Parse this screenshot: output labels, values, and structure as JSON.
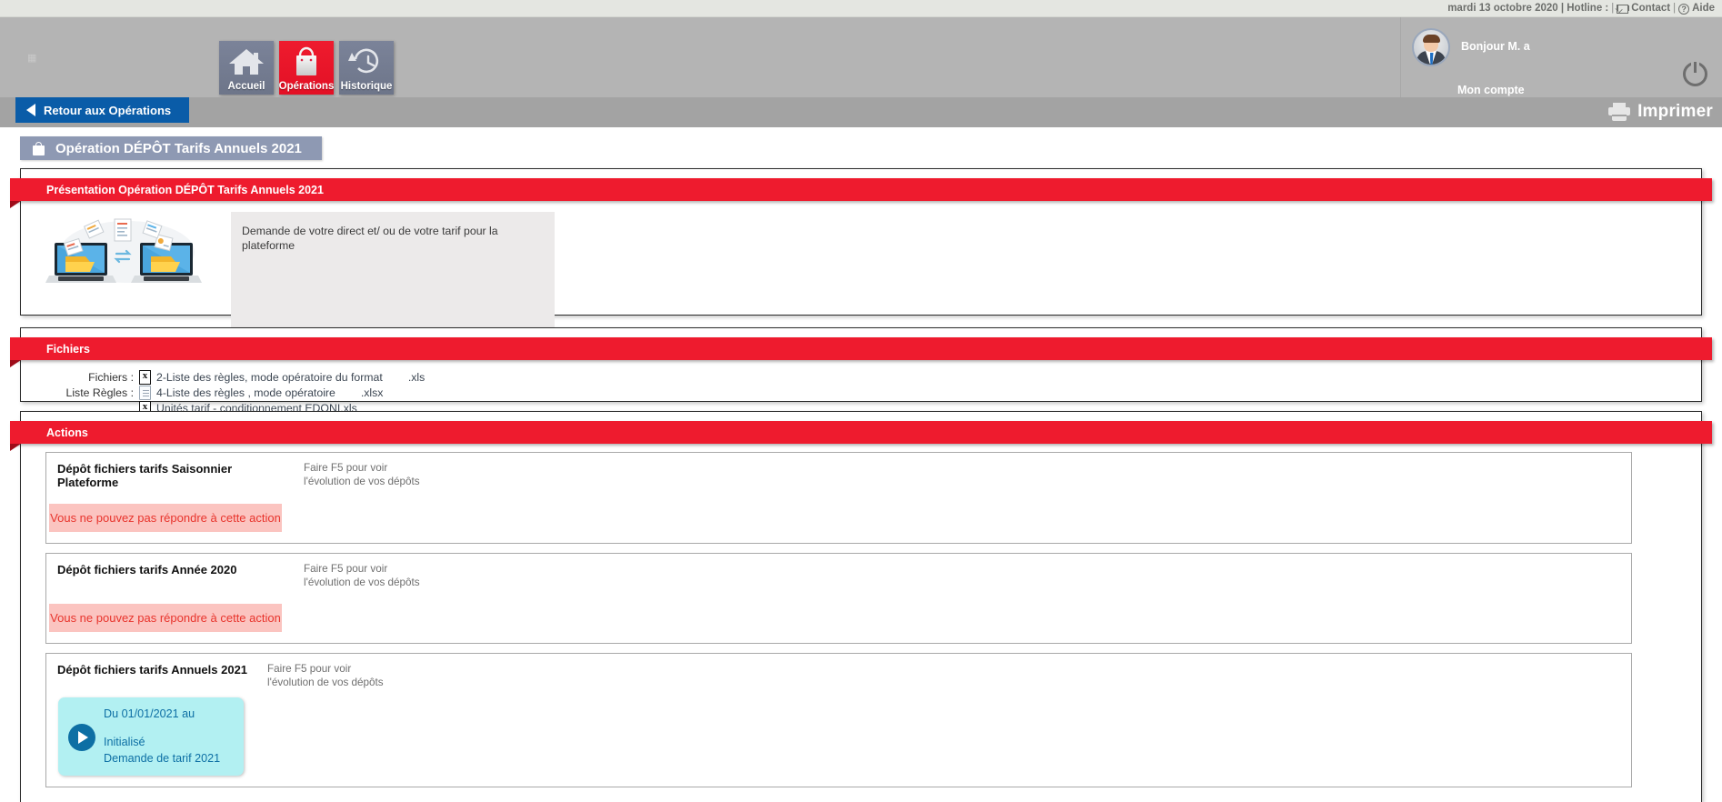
{
  "topbar": {
    "date_hotline": "mardi 13 octobre 2020 | Hotline :",
    "separator": "|",
    "contact_label": "Contact",
    "help_label": "Aide",
    "contact_icon": "mail-icon",
    "help_icon": "question-circle-icon"
  },
  "header": {
    "nav": [
      {
        "label": "Accueil",
        "icon": "home-icon",
        "active": false
      },
      {
        "label": "Opérations",
        "icon": "shopping-bag-icon",
        "active": true
      },
      {
        "label": "Historique",
        "icon": "clock-history-icon",
        "active": false
      }
    ],
    "account": {
      "greeting": "Bonjour M. a",
      "my_account_label": "Mon compte",
      "avatar_icon": "user-avatar",
      "logout_icon": "power-icon"
    }
  },
  "strip": {
    "back_label": "Retour aux Opérations",
    "back_icon": "arrow-left-icon",
    "print_label": "Imprimer",
    "print_icon": "printer-icon"
  },
  "page": {
    "operation_title": "Opération DÉPÔT Tarifs Annuels 2021",
    "operation_icon": "shopping-bag-icon"
  },
  "presentation": {
    "ribbon": "Présentation Opération DÉPÔT Tarifs Annuels 2021",
    "image_icon": "file-exchange-laptops-illustration",
    "description": "Demande de votre direct et/ ou de votre tarif pour la plateforme"
  },
  "fichiers": {
    "ribbon": "Fichiers",
    "rows": [
      {
        "label": "Fichiers :",
        "icon": "excel-file-icon",
        "name": "2-Liste des règles, mode opératoire du format",
        "ext": ".xls"
      },
      {
        "label": "Liste Règles :",
        "icon": "document-file-icon",
        "name": "4-Liste des règles , mode opératoire",
        "ext": ".xlsx"
      },
      {
        "label": "",
        "icon": "excel-file-icon",
        "name": "Unités tarif - conditionnement EDONI.xls",
        "ext": ""
      }
    ]
  },
  "actions": {
    "ribbon": "Actions",
    "cards": [
      {
        "title": "Dépôt fichiers tarifs Saisonnier Plateforme",
        "hint_line1": "Faire F5 pour voir",
        "hint_line2": "l'évolution de vos dépôts",
        "deny_message": "Vous ne pouvez pas répondre à cette action"
      },
      {
        "title": "Dépôt fichiers tarifs Année 2020",
        "hint_line1": "Faire F5 pour voir",
        "hint_line2": "l'évolution de vos dépôts",
        "deny_message": "Vous ne pouvez pas répondre à cette action"
      },
      {
        "title": "Dépôt fichiers tarifs Annuels 2021",
        "hint_line1": "Faire F5 pour voir",
        "hint_line2": "l'évolution de vos dépôts",
        "status": {
          "period": "Du 01/01/2021 au",
          "state": "Initialisé",
          "detail": "Demande de tarif 2021",
          "icon": "play-circle-icon"
        }
      }
    ]
  },
  "colors": {
    "accent_red": "#ee1b2e",
    "nav_blue_grey": "#7b8399",
    "back_blue": "#0a5ca8",
    "header_grey": "#b4b4b4",
    "strip_grey": "#a3a3a3",
    "title_bar": "#8e99b3",
    "deny_bg": "#fbc4c0",
    "deny_text": "#e8342c",
    "status_bg": "#b2f0f2",
    "status_text": "#0d6fa4"
  }
}
